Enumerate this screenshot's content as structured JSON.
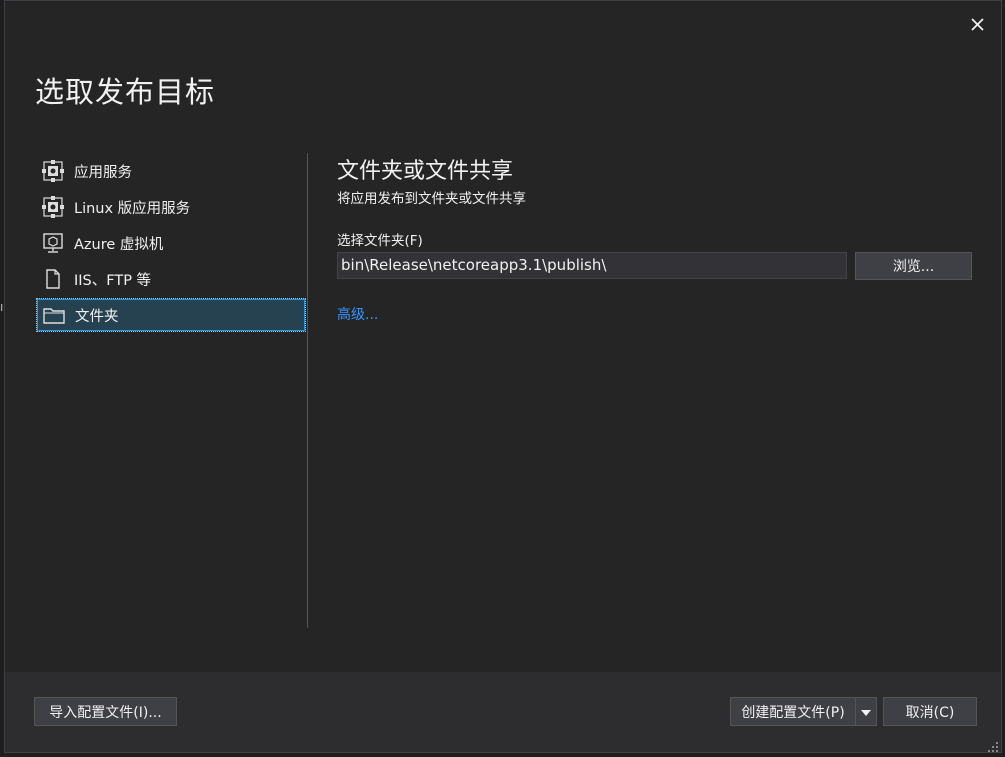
{
  "dialog": {
    "title": "选取发布目标",
    "close_icon": "close-icon"
  },
  "sidebar": {
    "items": [
      {
        "label": "应用服务",
        "icon": "app-service-icon"
      },
      {
        "label": "Linux 版应用服务",
        "icon": "app-service-linux-icon"
      },
      {
        "label": "Azure 虚拟机",
        "icon": "virtual-machine-icon"
      },
      {
        "label": "IIS、FTP 等",
        "icon": "document-icon"
      },
      {
        "label": "文件夹",
        "icon": "folder-icon",
        "selected": true
      }
    ]
  },
  "main": {
    "heading": "文件夹或文件共享",
    "description": "将应用发布到文件夹或文件共享",
    "folder_label": "选择文件夹(F)",
    "folder_value": "bin\\Release\\netcoreapp3.1\\publish\\",
    "browse_label": "浏览...",
    "advanced_link": "高级..."
  },
  "footer": {
    "import_label": "导入配置文件(I)...",
    "create_label": "创建配置文件(P)",
    "cancel_label": "取消(C)"
  },
  "colors": {
    "background": "#252526",
    "footer": "#2d2d30",
    "accent": "#1c97ea",
    "link": "#3794ff",
    "selected": "#264150"
  }
}
